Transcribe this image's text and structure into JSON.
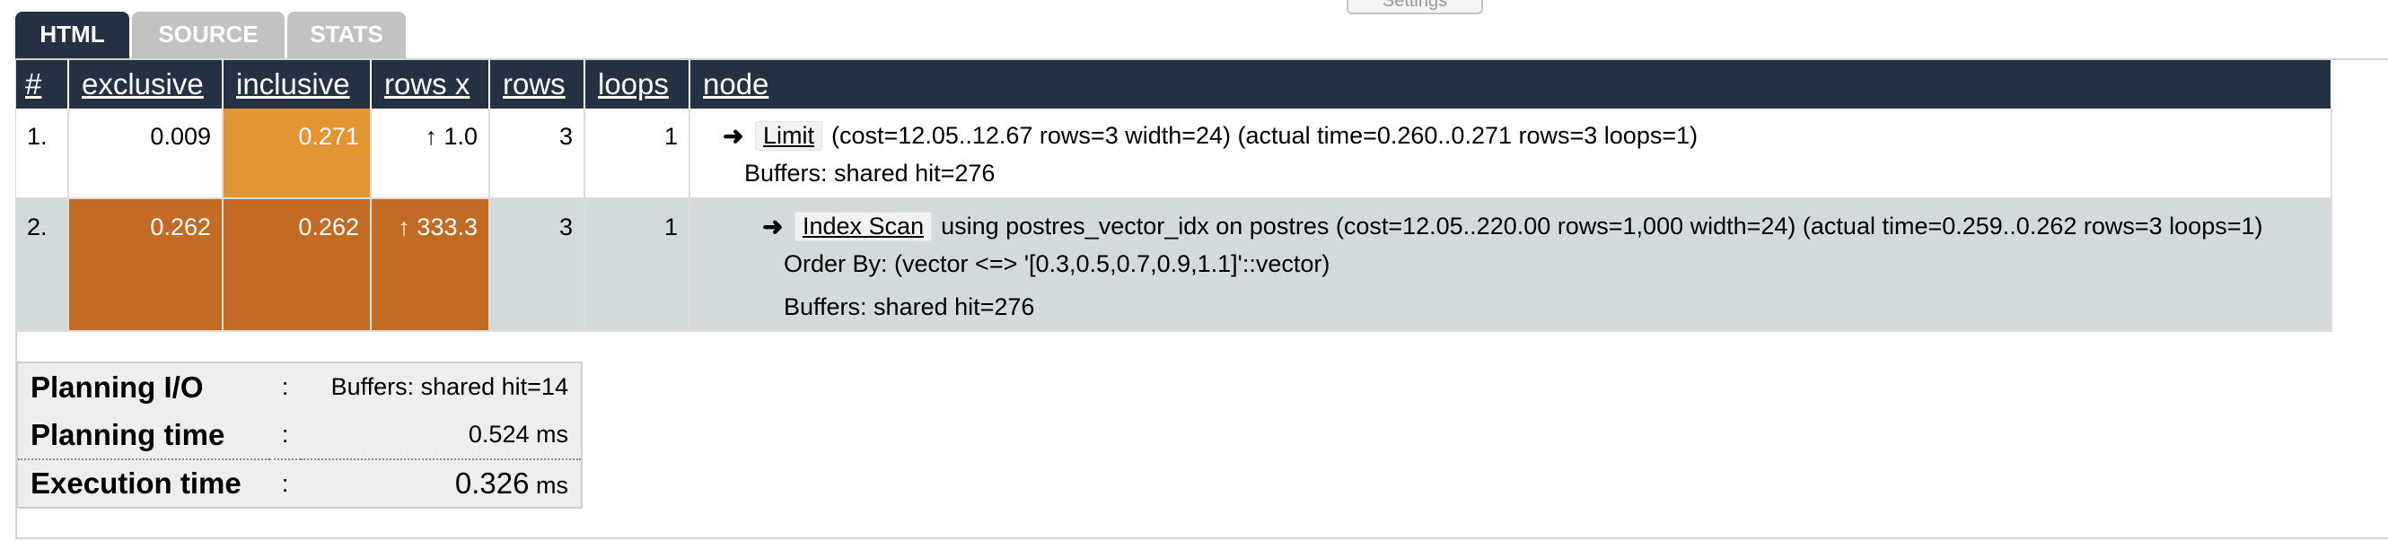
{
  "settings": {
    "label": "Settings"
  },
  "tabs": [
    {
      "label": "HTML",
      "active": true
    },
    {
      "label": "SOURCE",
      "active": false
    },
    {
      "label": "STATS",
      "active": false
    }
  ],
  "plan_table": {
    "headers": [
      "#",
      "exclusive",
      "inclusive",
      "rows x",
      "rows",
      "loops",
      "node"
    ],
    "rows": [
      {
        "index": "1.",
        "exclusive": "0.009",
        "inclusive": "0.271",
        "rows_x": "↑ 1.0",
        "rows": "3",
        "loops": "1",
        "node_type": "Limit",
        "node_detail": "(cost=12.05..12.67 rows=3 width=24) (actual time=0.260..0.271 rows=3 loops=1)",
        "extras": [
          "Buffers: shared hit=276"
        ]
      },
      {
        "index": "2.",
        "exclusive": "0.262",
        "inclusive": "0.262",
        "rows_x": "↑ 333.3",
        "rows": "3",
        "loops": "1",
        "node_type": "Index Scan",
        "node_detail": "using postres_vector_idx on postres (cost=12.05..220.00 rows=1,000 width=24) (actual time=0.259..0.262 rows=3 loops=1)",
        "extras": [
          "Order By: (vector <=> '[0.3,0.5,0.7,0.9,1.1]'::vector)",
          "Buffers: shared hit=276"
        ]
      }
    ],
    "arrow_icon": "right-arrow-icon",
    "colors": {
      "header_bg": "#243142",
      "heat_medium": "#e39435",
      "heat_high": "#c16b25",
      "row_highlight": "#d2dadb"
    }
  },
  "stats": {
    "planning_io": {
      "label": "Planning I/O",
      "colon": ":",
      "value": "Buffers: shared hit=14"
    },
    "planning_time": {
      "label": "Planning time",
      "colon": ":",
      "value": "0.524",
      "unit": "ms"
    },
    "execution_time": {
      "label": "Execution time",
      "colon": ":",
      "value": "0.326",
      "unit": "ms"
    }
  }
}
